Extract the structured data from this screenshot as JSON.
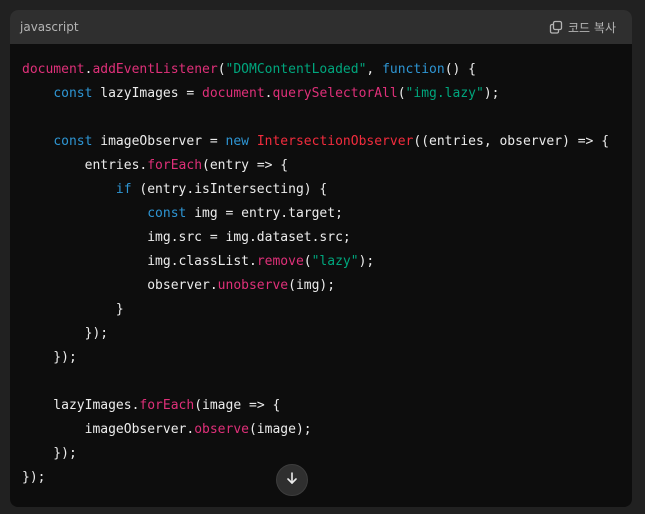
{
  "code_block": {
    "language": "javascript",
    "copy_label": "코드 복사",
    "lines": [
      [
        {
          "t": "document",
          "c": "object"
        },
        {
          "t": ".",
          "c": "default"
        },
        {
          "t": "addEventListener",
          "c": "method"
        },
        {
          "t": "(",
          "c": "default"
        },
        {
          "t": "\"DOMContentLoaded\"",
          "c": "string"
        },
        {
          "t": ", ",
          "c": "default"
        },
        {
          "t": "function",
          "c": "keyword"
        },
        {
          "t": "() {",
          "c": "default"
        }
      ],
      [
        {
          "t": "    ",
          "c": "default"
        },
        {
          "t": "const",
          "c": "keyword"
        },
        {
          "t": " lazyImages = ",
          "c": "default"
        },
        {
          "t": "document",
          "c": "object"
        },
        {
          "t": ".",
          "c": "default"
        },
        {
          "t": "querySelectorAll",
          "c": "method"
        },
        {
          "t": "(",
          "c": "default"
        },
        {
          "t": "\"img.lazy\"",
          "c": "string"
        },
        {
          "t": ");",
          "c": "default"
        }
      ],
      [],
      [
        {
          "t": "    ",
          "c": "default"
        },
        {
          "t": "const",
          "c": "keyword"
        },
        {
          "t": " imageObserver = ",
          "c": "default"
        },
        {
          "t": "new",
          "c": "keyword"
        },
        {
          "t": " ",
          "c": "default"
        },
        {
          "t": "IntersectionObserver",
          "c": "class"
        },
        {
          "t": "((entries, observer) => {",
          "c": "default"
        }
      ],
      [
        {
          "t": "        entries.",
          "c": "default"
        },
        {
          "t": "forEach",
          "c": "method"
        },
        {
          "t": "(entry => {",
          "c": "default"
        }
      ],
      [
        {
          "t": "            ",
          "c": "default"
        },
        {
          "t": "if",
          "c": "keyword"
        },
        {
          "t": " (entry.isIntersecting) {",
          "c": "default"
        }
      ],
      [
        {
          "t": "                ",
          "c": "default"
        },
        {
          "t": "const",
          "c": "keyword"
        },
        {
          "t": " img = entry.target;",
          "c": "default"
        }
      ],
      [
        {
          "t": "                img.src = img.dataset.src;",
          "c": "default"
        }
      ],
      [
        {
          "t": "                img.classList.",
          "c": "default"
        },
        {
          "t": "remove",
          "c": "method"
        },
        {
          "t": "(",
          "c": "default"
        },
        {
          "t": "\"lazy\"",
          "c": "string"
        },
        {
          "t": ");",
          "c": "default"
        }
      ],
      [
        {
          "t": "                observer.",
          "c": "default"
        },
        {
          "t": "unobserve",
          "c": "method"
        },
        {
          "t": "(img);",
          "c": "default"
        }
      ],
      [
        {
          "t": "            }",
          "c": "default"
        }
      ],
      [
        {
          "t": "        });",
          "c": "default"
        }
      ],
      [
        {
          "t": "    });",
          "c": "default"
        }
      ],
      [],
      [
        {
          "t": "    lazyImages.",
          "c": "default"
        },
        {
          "t": "forEach",
          "c": "method"
        },
        {
          "t": "(image => {",
          "c": "default"
        }
      ],
      [
        {
          "t": "        imageObserver.",
          "c": "default"
        },
        {
          "t": "observe",
          "c": "method"
        },
        {
          "t": "(image);",
          "c": "default"
        }
      ],
      [
        {
          "t": "    });",
          "c": "default"
        }
      ],
      [
        {
          "t": "});",
          "c": "default"
        }
      ]
    ]
  },
  "icons": {
    "copy": "copy-icon",
    "scroll_down": "arrow-down-icon"
  },
  "colors": {
    "page_background": "#212121",
    "code_background": "#0d0d0d",
    "header_background": "#2f2f2f",
    "keyword": "#2e95d3",
    "string": "#00a67d",
    "method": "#df3079",
    "class": "#f22c3d"
  }
}
